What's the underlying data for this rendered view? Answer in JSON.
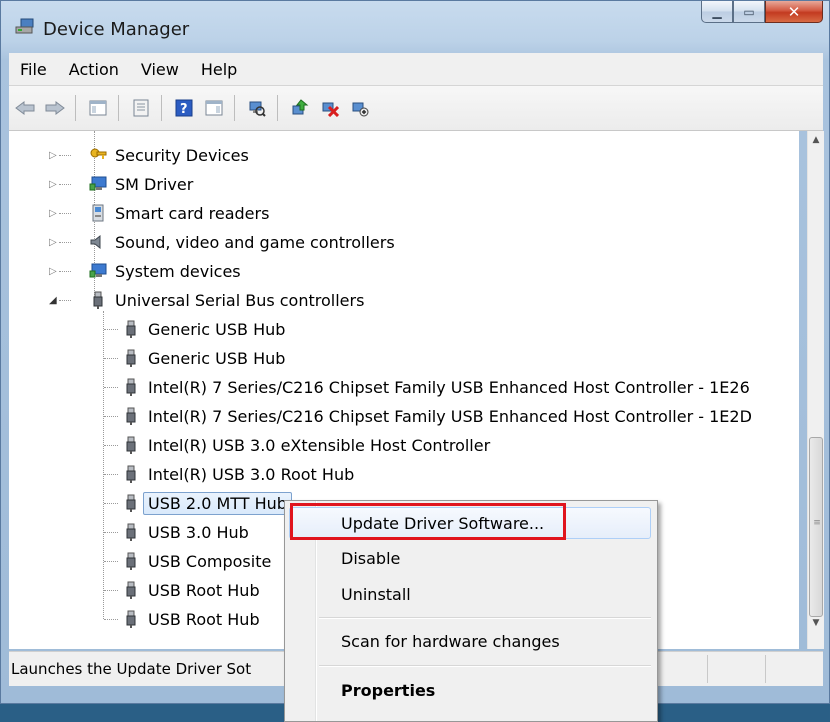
{
  "window": {
    "title": "Device Manager"
  },
  "menubar": [
    "File",
    "Action",
    "View",
    "Help"
  ],
  "toolbar": [
    "back-icon",
    "forward-icon",
    "show-hide-tree-icon",
    "properties-icon",
    "help-icon",
    "action-pane-icon",
    "scan-hardware-icon",
    "update-driver-icon",
    "uninstall-icon",
    "enable-disable-icon"
  ],
  "tree": {
    "categories": [
      {
        "label": "Security Devices",
        "icon": "key-icon",
        "expanded": false
      },
      {
        "label": "SM Driver",
        "icon": "monitor-icon",
        "expanded": false
      },
      {
        "label": "Smart card readers",
        "icon": "card-reader-icon",
        "expanded": false
      },
      {
        "label": "Sound, video and game controllers",
        "icon": "speaker-icon",
        "expanded": false
      },
      {
        "label": "System devices",
        "icon": "monitor-icon",
        "expanded": false
      },
      {
        "label": "Universal Serial Bus controllers",
        "icon": "usb-icon",
        "expanded": true
      }
    ],
    "usb_children": [
      "Generic USB Hub",
      "Generic USB Hub",
      "Intel(R) 7 Series/C216 Chipset Family USB Enhanced Host Controller - 1E26",
      "Intel(R) 7 Series/C216 Chipset Family USB Enhanced Host Controller - 1E2D",
      "Intel(R) USB 3.0 eXtensible Host Controller",
      "Intel(R) USB 3.0 Root Hub",
      "USB 2.0 MTT Hub",
      "USB 3.0 Hub",
      "USB Composite",
      "USB Root Hub",
      "USB Root Hub"
    ]
  },
  "statusbar": {
    "text": "Launches the Update Driver Sot"
  },
  "context_menu": {
    "items": [
      "Update Driver Software...",
      "Disable",
      "Uninstall",
      "Scan for hardware changes",
      "Properties"
    ]
  }
}
